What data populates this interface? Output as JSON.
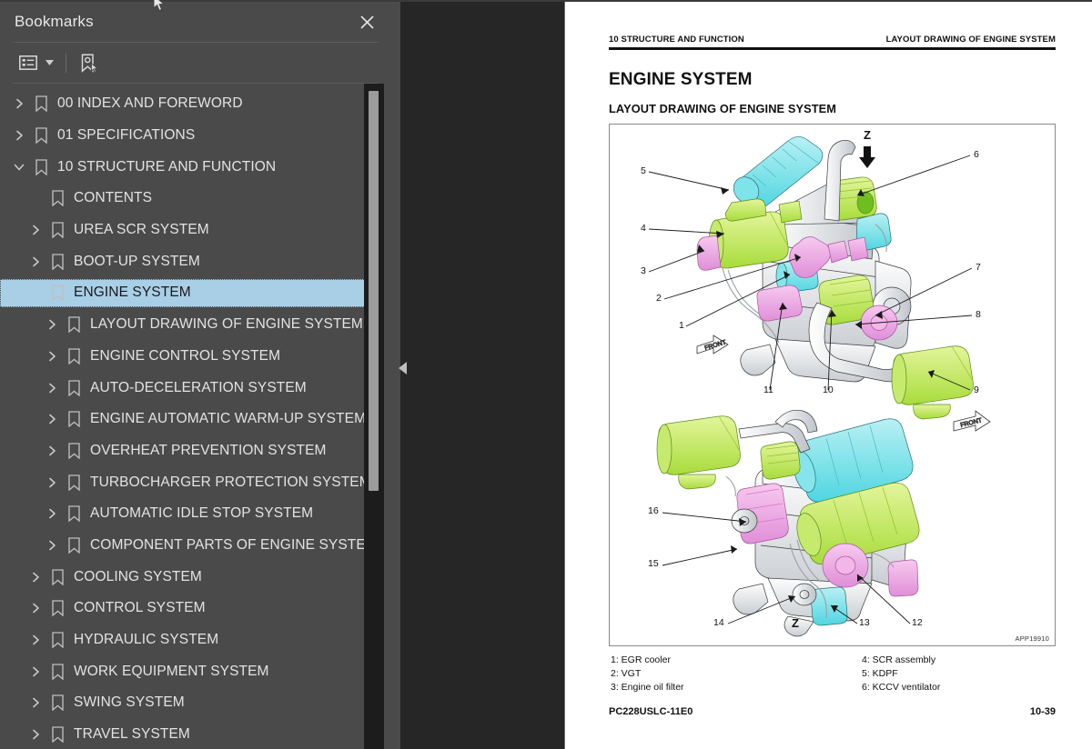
{
  "sidebar": {
    "title": "Bookmarks",
    "close_icon": "close-icon",
    "toolbar": {
      "options_icon": "list-options-icon",
      "caret_icon": "chevron-down-icon",
      "new_bookmark_icon": "new-bookmark-icon"
    },
    "items": [
      {
        "label": "00 INDEX AND FOREWORD",
        "level": 0,
        "state": "collapsed",
        "selected": false
      },
      {
        "label": "01 SPECIFICATIONS",
        "level": 0,
        "state": "collapsed",
        "selected": false
      },
      {
        "label": "10 STRUCTURE AND FUNCTION",
        "level": 0,
        "state": "expanded",
        "selected": false
      },
      {
        "label": "CONTENTS",
        "level": 1,
        "state": "leaf",
        "selected": false
      },
      {
        "label": "UREA SCR SYSTEM",
        "level": 1,
        "state": "collapsed",
        "selected": false
      },
      {
        "label": "BOOT-UP SYSTEM",
        "level": 1,
        "state": "collapsed",
        "selected": false
      },
      {
        "label": "ENGINE SYSTEM",
        "level": 1,
        "state": "expanded",
        "selected": true
      },
      {
        "label": "LAYOUT DRAWING OF ENGINE SYSTEM",
        "level": 2,
        "state": "collapsed",
        "selected": false
      },
      {
        "label": "ENGINE CONTROL SYSTEM",
        "level": 2,
        "state": "collapsed",
        "selected": false
      },
      {
        "label": "AUTO-DECELERATION SYSTEM",
        "level": 2,
        "state": "collapsed",
        "selected": false
      },
      {
        "label": "ENGINE AUTOMATIC WARM-UP SYSTEM",
        "level": 2,
        "state": "collapsed",
        "selected": false
      },
      {
        "label": "OVERHEAT PREVENTION SYSTEM",
        "level": 2,
        "state": "collapsed",
        "selected": false
      },
      {
        "label": "TURBOCHARGER PROTECTION SYSTEM",
        "level": 2,
        "state": "collapsed",
        "selected": false
      },
      {
        "label": "AUTOMATIC IDLE STOP SYSTEM",
        "level": 2,
        "state": "collapsed",
        "selected": false
      },
      {
        "label": "COMPONENT PARTS OF ENGINE SYSTEM",
        "level": 2,
        "state": "collapsed",
        "selected": false
      },
      {
        "label": "COOLING SYSTEM",
        "level": 1,
        "state": "collapsed",
        "selected": false
      },
      {
        "label": "CONTROL SYSTEM",
        "level": 1,
        "state": "collapsed",
        "selected": false
      },
      {
        "label": "HYDRAULIC SYSTEM",
        "level": 1,
        "state": "collapsed",
        "selected": false
      },
      {
        "label": "WORK EQUIPMENT SYSTEM",
        "level": 1,
        "state": "collapsed",
        "selected": false
      },
      {
        "label": "SWING SYSTEM",
        "level": 1,
        "state": "collapsed",
        "selected": false
      },
      {
        "label": "TRAVEL SYSTEM",
        "level": 1,
        "state": "collapsed",
        "selected": false
      }
    ],
    "selected_label": "ENGINE SYSTEM",
    "highlight_color": "#a9cfe6",
    "background_color": "#4a4a4a"
  },
  "panel": {
    "collapse_handle_icon": "triangle-left-icon"
  },
  "document": {
    "running_head_left": "10 STRUCTURE AND FUNCTION",
    "running_head_right": "LAYOUT DRAWING OF ENGINE SYSTEM",
    "heading": "ENGINE SYSTEM",
    "subheading": "LAYOUT DRAWING OF ENGINE SYSTEM",
    "figure_code": "APP19910",
    "legend_left": [
      "1: EGR cooler",
      "2: VGT",
      "3: Engine oil filter"
    ],
    "legend_right": [
      "4: SCR assembly",
      "5: KDPF",
      "6: KCCV ventilator"
    ],
    "footer_left": "PC228USLC-11E0",
    "footer_right": "10-39",
    "figure": {
      "view_top": {
        "orientation_mark": "Z",
        "orientation_arrow": "down-arrow-icon",
        "front_marker": "FRONT",
        "callouts": [
          "5",
          "4",
          "3",
          "2",
          "1",
          "6",
          "7",
          "8",
          "9",
          "10",
          "11"
        ]
      },
      "view_bottom": {
        "orientation_mark": "Z",
        "front_marker": "FRONT",
        "callouts": [
          "16",
          "15",
          "14",
          "13",
          "12"
        ]
      }
    }
  }
}
